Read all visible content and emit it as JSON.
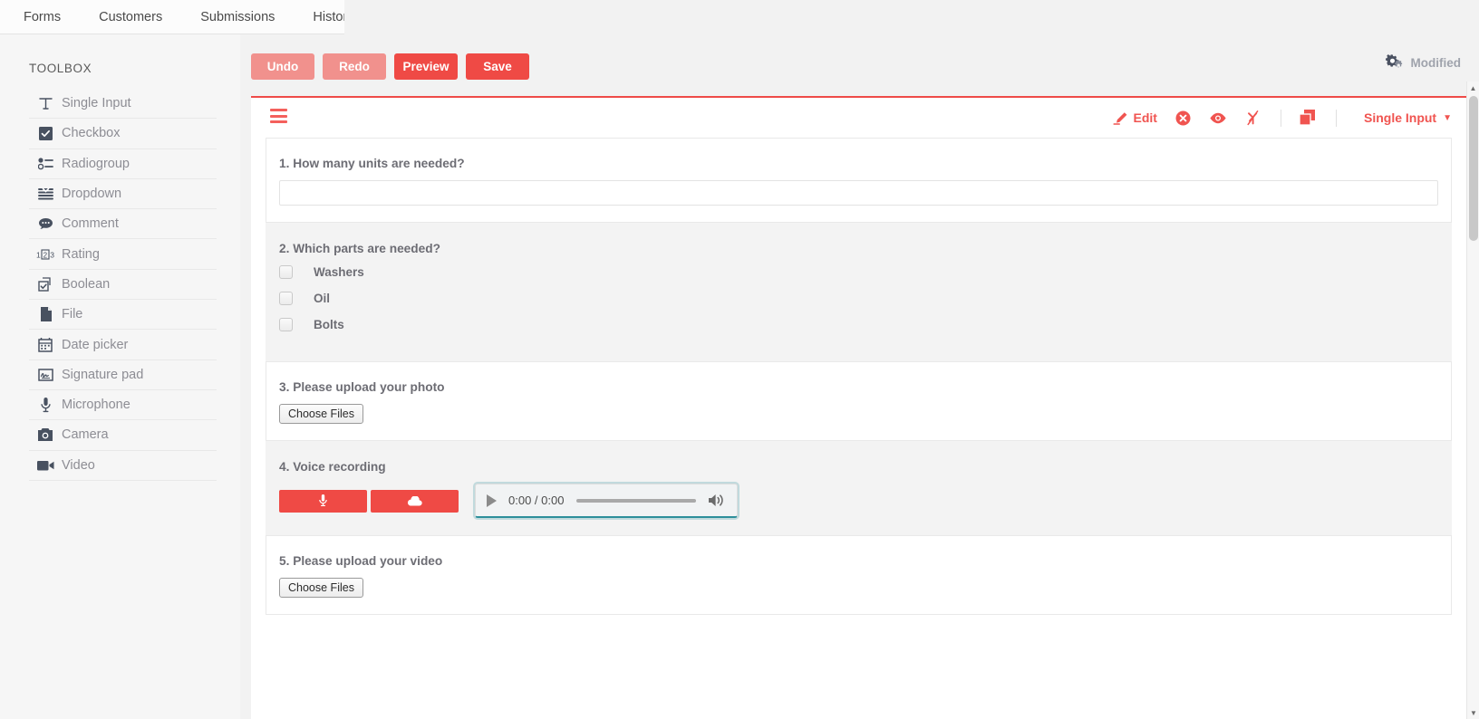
{
  "topnav": {
    "items": [
      {
        "label": "Forms"
      },
      {
        "label": "Customers"
      },
      {
        "label": "Submissions"
      },
      {
        "label": "History"
      }
    ]
  },
  "toolbox": {
    "title": "TOOLBOX",
    "items": [
      {
        "label": "Single Input",
        "icon": "text-input-icon"
      },
      {
        "label": "Checkbox",
        "icon": "checkbox-icon"
      },
      {
        "label": "Radiogroup",
        "icon": "radiogroup-icon"
      },
      {
        "label": "Dropdown",
        "icon": "dropdown-icon"
      },
      {
        "label": "Comment",
        "icon": "comment-icon"
      },
      {
        "label": "Rating",
        "icon": "rating-icon"
      },
      {
        "label": "Boolean",
        "icon": "boolean-icon"
      },
      {
        "label": "File",
        "icon": "file-icon"
      },
      {
        "label": "Date picker",
        "icon": "calendar-icon"
      },
      {
        "label": "Signature pad",
        "icon": "signature-icon"
      },
      {
        "label": "Microphone",
        "icon": "microphone-icon"
      },
      {
        "label": "Camera",
        "icon": "camera-icon"
      },
      {
        "label": "Video",
        "icon": "video-icon"
      }
    ]
  },
  "toolbar": {
    "undo_label": "Undo",
    "redo_label": "Redo",
    "preview_label": "Preview",
    "save_label": "Save",
    "status_label": "Modified"
  },
  "designer": {
    "header": {
      "edit_label": "Edit",
      "type_label": "Single Input",
      "caret": "▼"
    },
    "questions": [
      {
        "title": "1. How many units are needed?",
        "type": "text"
      },
      {
        "title": "2. Which parts are needed?",
        "type": "checkbox",
        "choices": [
          "Washers",
          "Oil",
          "Bolts"
        ]
      },
      {
        "title": "3. Please upload your photo",
        "type": "file",
        "button_label": "Choose Files"
      },
      {
        "title": "4. Voice recording",
        "type": "audio",
        "player": {
          "time": "0:00 / 0:00"
        }
      },
      {
        "title": "5. Please upload your video",
        "type": "file",
        "button_label": "Choose Files"
      }
    ]
  },
  "colors": {
    "accent": "#ef4a45",
    "accent_pale": "#f1918d",
    "text_muted": "#8d8d94",
    "question_text": "#6d6d74",
    "audio_focus": "#2d8f9b"
  }
}
